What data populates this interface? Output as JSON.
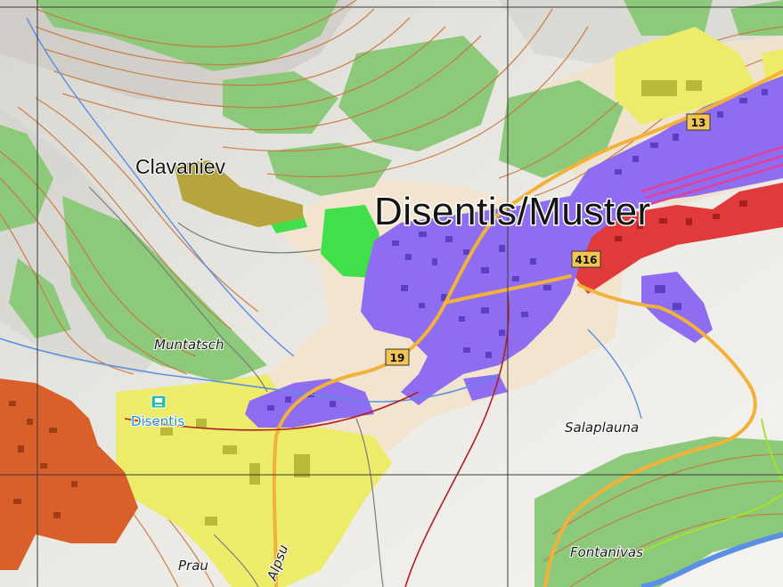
{
  "map": {
    "labels": {
      "town": "Disentis/Muster",
      "village": "Clavaniev",
      "places": {
        "muntatsch": "Muntatsch",
        "salaplauna": "Salaplauna",
        "prau": "Prau",
        "fontanivas": "Fontanivas",
        "alpsu": "Alpsu"
      },
      "station": "Disentis"
    },
    "road_shields": {
      "r19": "19",
      "r13": "13",
      "r416": "416"
    },
    "icons": {
      "station": "train-station-icon"
    },
    "colors": {
      "residential": "#8f6df0",
      "industrial": "#ecec6a",
      "commercial": "#e03a3a",
      "other_town": "#d9602a",
      "forest": "#8cc97a",
      "park": "#41e04a",
      "contour": "#c8753d",
      "road": "#f2b23a",
      "water": "#5b8fe3",
      "grid": "#3a3a3a",
      "olive": "#b6a43c"
    }
  }
}
